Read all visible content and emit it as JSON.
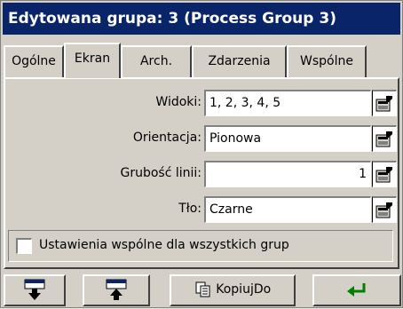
{
  "title": "Edytowana grupa: 3 (Process Group 3)",
  "tabs": [
    {
      "label": "Ogólne",
      "active": false
    },
    {
      "label": "Ekran",
      "active": true
    },
    {
      "label": "Arch.",
      "active": false
    },
    {
      "label": "Zdarzenia",
      "active": false
    },
    {
      "label": "Wspólne",
      "active": false
    }
  ],
  "fields": [
    {
      "label": "Widoki:",
      "value": "1, 2, 3, 4, 5"
    },
    {
      "label": "Orientacja:",
      "value": "Pionowa"
    },
    {
      "label": "Grubość linii:",
      "value": "1"
    },
    {
      "label": "Tło:",
      "value": "Czarne"
    }
  ],
  "checkbox": {
    "label": "Ustawienia wspólne dla wszystkich grup",
    "checked": false
  },
  "buttons": {
    "save_icon": "save-to-device-icon",
    "load_icon": "load-from-device-icon",
    "copy_label": "KopiujDo",
    "copy_icon": "copy-icon",
    "enter_icon": "enter-arrow-icon"
  },
  "colors": {
    "titlebar": "#0a246a",
    "enter_arrow": "#008000"
  }
}
